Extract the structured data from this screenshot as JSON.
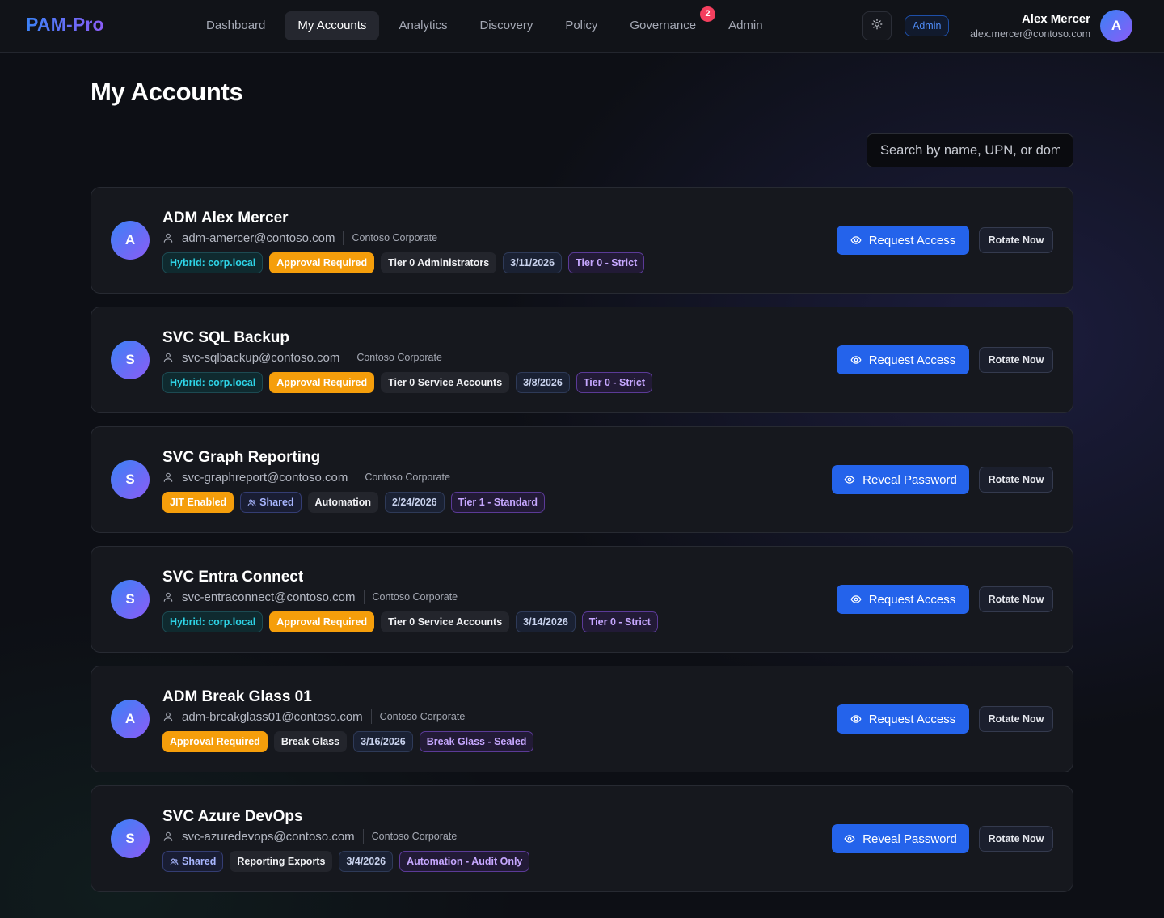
{
  "app": {
    "brand": "PAM-Pro"
  },
  "nav": {
    "items": [
      {
        "label": "Dashboard",
        "active": false
      },
      {
        "label": "My Accounts",
        "active": true
      },
      {
        "label": "Analytics",
        "active": false
      },
      {
        "label": "Discovery",
        "active": false
      },
      {
        "label": "Policy",
        "active": false
      },
      {
        "label": "Governance",
        "active": false,
        "badge": "2"
      },
      {
        "label": "Admin",
        "active": false
      }
    ]
  },
  "header": {
    "theme_icon": "sun-icon",
    "role_chip": "Admin",
    "user": {
      "name": "Alex Mercer",
      "email": "alex.mercer@contoso.com",
      "initial": "A"
    }
  },
  "page": {
    "title": "My Accounts",
    "search_placeholder": "Search by name, UPN, or domain..."
  },
  "colors": {
    "accent": "#2463eb",
    "brand_gradient": [
      "#3b82f6",
      "#8b5cf6"
    ],
    "warning": "#f59e0b",
    "badge": "#f43f5e"
  },
  "accounts": [
    {
      "initial": "A",
      "name": "ADM Alex Mercer",
      "upn": "adm-amercer@contoso.com",
      "org": "Contoso Corporate",
      "action": "Request Access",
      "rotate": "Rotate Now",
      "tags": [
        {
          "text": "Hybrid: corp.local",
          "kind": "hybrid"
        },
        {
          "text": "Approval Required",
          "kind": "approval"
        },
        {
          "text": "Tier 0 Administrators",
          "kind": "group"
        },
        {
          "text": "3/11/2026",
          "kind": "date"
        },
        {
          "text": "Tier 0 - Strict",
          "kind": "tier"
        }
      ]
    },
    {
      "initial": "S",
      "name": "SVC SQL Backup",
      "upn": "svc-sqlbackup@contoso.com",
      "org": "Contoso Corporate",
      "action": "Request Access",
      "rotate": "Rotate Now",
      "tags": [
        {
          "text": "Hybrid: corp.local",
          "kind": "hybrid"
        },
        {
          "text": "Approval Required",
          "kind": "approval"
        },
        {
          "text": "Tier 0 Service Accounts",
          "kind": "group"
        },
        {
          "text": "3/8/2026",
          "kind": "date"
        },
        {
          "text": "Tier 0 - Strict",
          "kind": "tier"
        }
      ]
    },
    {
      "initial": "S",
      "name": "SVC Graph Reporting",
      "upn": "svc-graphreport@contoso.com",
      "org": "Contoso Corporate",
      "action": "Reveal Password",
      "rotate": "Rotate Now",
      "tags": [
        {
          "text": "JIT Enabled",
          "kind": "jit"
        },
        {
          "text": "Shared",
          "kind": "shared"
        },
        {
          "text": "Automation",
          "kind": "group"
        },
        {
          "text": "2/24/2026",
          "kind": "date"
        },
        {
          "text": "Tier 1 - Standard",
          "kind": "tier"
        }
      ]
    },
    {
      "initial": "S",
      "name": "SVC Entra Connect",
      "upn": "svc-entraconnect@contoso.com",
      "org": "Contoso Corporate",
      "action": "Request Access",
      "rotate": "Rotate Now",
      "tags": [
        {
          "text": "Hybrid: corp.local",
          "kind": "hybrid"
        },
        {
          "text": "Approval Required",
          "kind": "approval"
        },
        {
          "text": "Tier 0 Service Accounts",
          "kind": "group"
        },
        {
          "text": "3/14/2026",
          "kind": "date"
        },
        {
          "text": "Tier 0 - Strict",
          "kind": "tier"
        }
      ]
    },
    {
      "initial": "A",
      "name": "ADM Break Glass 01",
      "upn": "adm-breakglass01@contoso.com",
      "org": "Contoso Corporate",
      "action": "Request Access",
      "rotate": "Rotate Now",
      "tags": [
        {
          "text": "Approval Required",
          "kind": "approval"
        },
        {
          "text": "Break Glass",
          "kind": "group"
        },
        {
          "text": "3/16/2026",
          "kind": "date"
        },
        {
          "text": "Break Glass - Sealed",
          "kind": "tier"
        }
      ]
    },
    {
      "initial": "S",
      "name": "SVC Azure DevOps",
      "upn": "svc-azuredevops@contoso.com",
      "org": "Contoso Corporate",
      "action": "Reveal Password",
      "rotate": "Rotate Now",
      "tags": [
        {
          "text": "Shared",
          "kind": "shared"
        },
        {
          "text": "Reporting Exports",
          "kind": "group"
        },
        {
          "text": "3/4/2026",
          "kind": "date"
        },
        {
          "text": "Automation - Audit Only",
          "kind": "tier"
        }
      ]
    }
  ]
}
